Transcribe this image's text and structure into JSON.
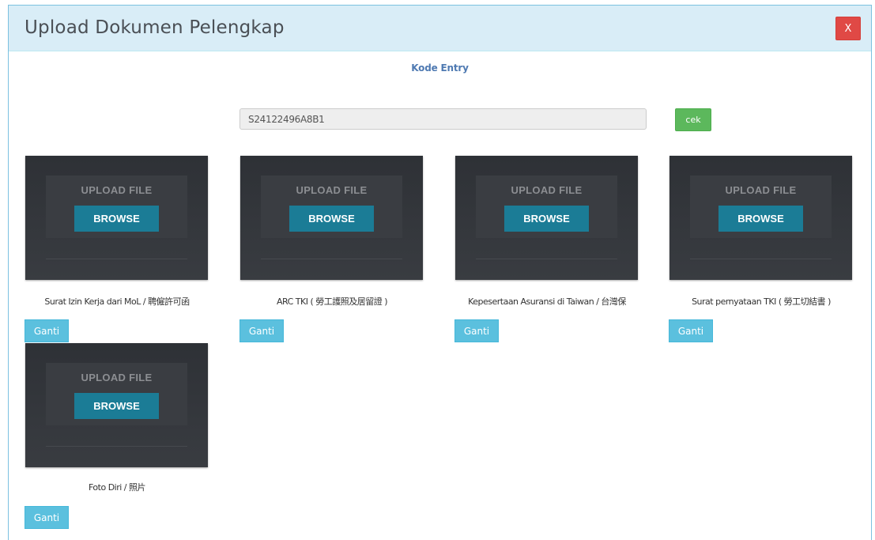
{
  "modal": {
    "title": "Upload Dokumen Pelengkap",
    "close_label": "X"
  },
  "kode_entry": {
    "label": "Kode Entry",
    "value": "S24122496A8B1",
    "check_label": "cek"
  },
  "documents": [
    {
      "upload_title": "UPLOAD FILE",
      "browse_label": "BROWSE",
      "label": "Surat Izin Kerja dari MoL / 聘僱許可函",
      "change_label": "Ganti"
    },
    {
      "upload_title": "UPLOAD FILE",
      "browse_label": "BROWSE",
      "label": "ARC TKI ( 勞工護照及居留證 )",
      "change_label": "Ganti"
    },
    {
      "upload_title": "UPLOAD FILE",
      "browse_label": "BROWSE",
      "label": "Kepesertaan Asuransi di Taiwan / 台灣保",
      "change_label": "Ganti"
    },
    {
      "upload_title": "UPLOAD FILE",
      "browse_label": "BROWSE",
      "label": "Surat pernyataan TKI ( 勞工切結書 )",
      "change_label": "Ganti"
    },
    {
      "upload_title": "UPLOAD FILE",
      "browse_label": "BROWSE",
      "label": "Foto Diri / 照片",
      "change_label": "Ganti"
    }
  ],
  "colors": {
    "header_bg": "#d9edf7",
    "close_button": "#e04945",
    "check_button": "#5cb85c",
    "browse_button": "#1b7c96",
    "change_button": "#5bc0de",
    "upload_panel": "#2e3136"
  }
}
